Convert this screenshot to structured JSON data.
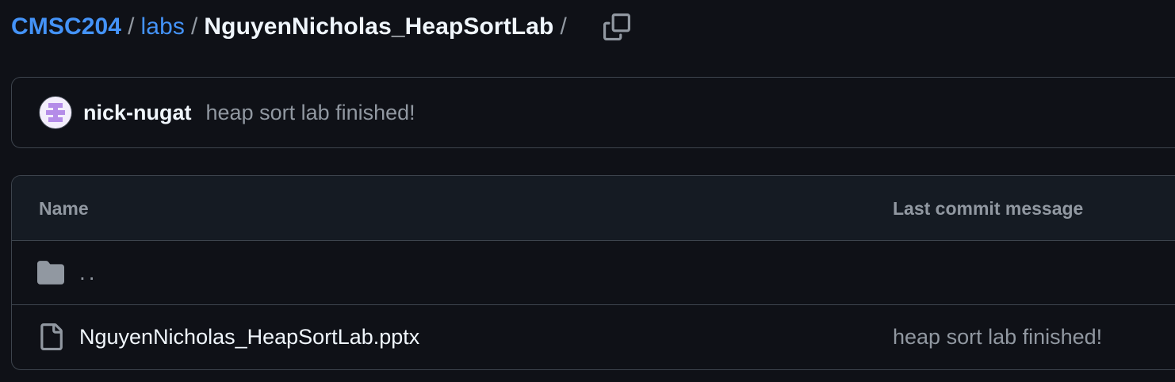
{
  "breadcrumb": {
    "root": "CMSC204",
    "folder": "labs",
    "current": "NguyenNicholas_HeapSortLab",
    "separator": "/"
  },
  "copy_button": {
    "icon": "copy-icon"
  },
  "latest_commit": {
    "author": "nick-nugat",
    "message": "heap sort lab finished!",
    "avatar_icon": "identicon-avatar",
    "avatar_color": "#b48ce8"
  },
  "file_table": {
    "columns": [
      "Name",
      "Last commit message"
    ],
    "rows": [
      {
        "icon": "folder-icon",
        "name": "..",
        "message": ""
      },
      {
        "icon": "file-icon",
        "name": "NguyenNicholas_HeapSortLab.pptx",
        "message": "heap sort lab finished!"
      }
    ]
  },
  "colors": {
    "background": "#0f1117",
    "link": "#4493f8",
    "border": "#3d444d",
    "muted": "#9198a1"
  }
}
